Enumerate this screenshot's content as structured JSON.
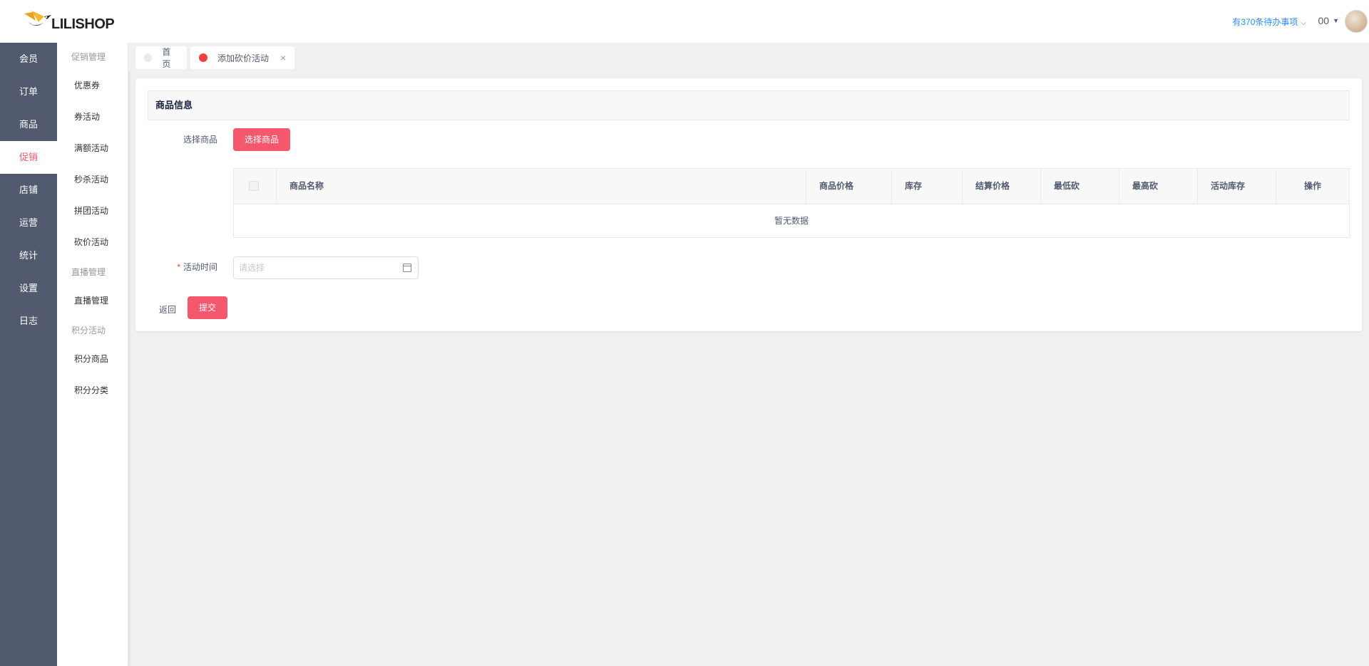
{
  "brand": {
    "logo_text": "LILISHOP"
  },
  "nav_primary": [
    {
      "label": "会员",
      "active": false
    },
    {
      "label": "订单",
      "active": false
    },
    {
      "label": "商品",
      "active": false
    },
    {
      "label": "促销",
      "active": true
    },
    {
      "label": "店铺",
      "active": false
    },
    {
      "label": "运营",
      "active": false
    },
    {
      "label": "统计",
      "active": false
    },
    {
      "label": "设置",
      "active": false
    },
    {
      "label": "日志",
      "active": false
    }
  ],
  "nav_secondary": {
    "group1": "促销管理",
    "items1": [
      "优惠券",
      "券活动",
      "满额活动",
      "秒杀活动",
      "拼团活动",
      "砍价活动"
    ],
    "group2": "直播管理",
    "items2": [
      "直播管理"
    ],
    "group3": "积分活动",
    "items3": [
      "积分商品",
      "积分分类"
    ]
  },
  "header": {
    "todo": "有370条待办事项",
    "username": "00"
  },
  "tabs": [
    {
      "label": "首页",
      "active": false
    },
    {
      "label": "添加砍价活动",
      "active": true,
      "closable": true
    }
  ],
  "form": {
    "section_title": "商品信息",
    "select_goods_label": "选择商品",
    "select_goods_button": "选择商品",
    "table_columns": [
      "商品名称",
      "商品价格",
      "库存",
      "结算价格",
      "最低砍",
      "最高砍",
      "活动库存",
      "操作"
    ],
    "empty_text": "暂无数据",
    "time_label": "活动时间",
    "time_placeholder": "请选择",
    "back_label": "返回",
    "submit_label": "提交"
  },
  "colors": {
    "accent": "#f5576c",
    "sidebar": "#515a6e",
    "link": "#2d8cf0"
  }
}
